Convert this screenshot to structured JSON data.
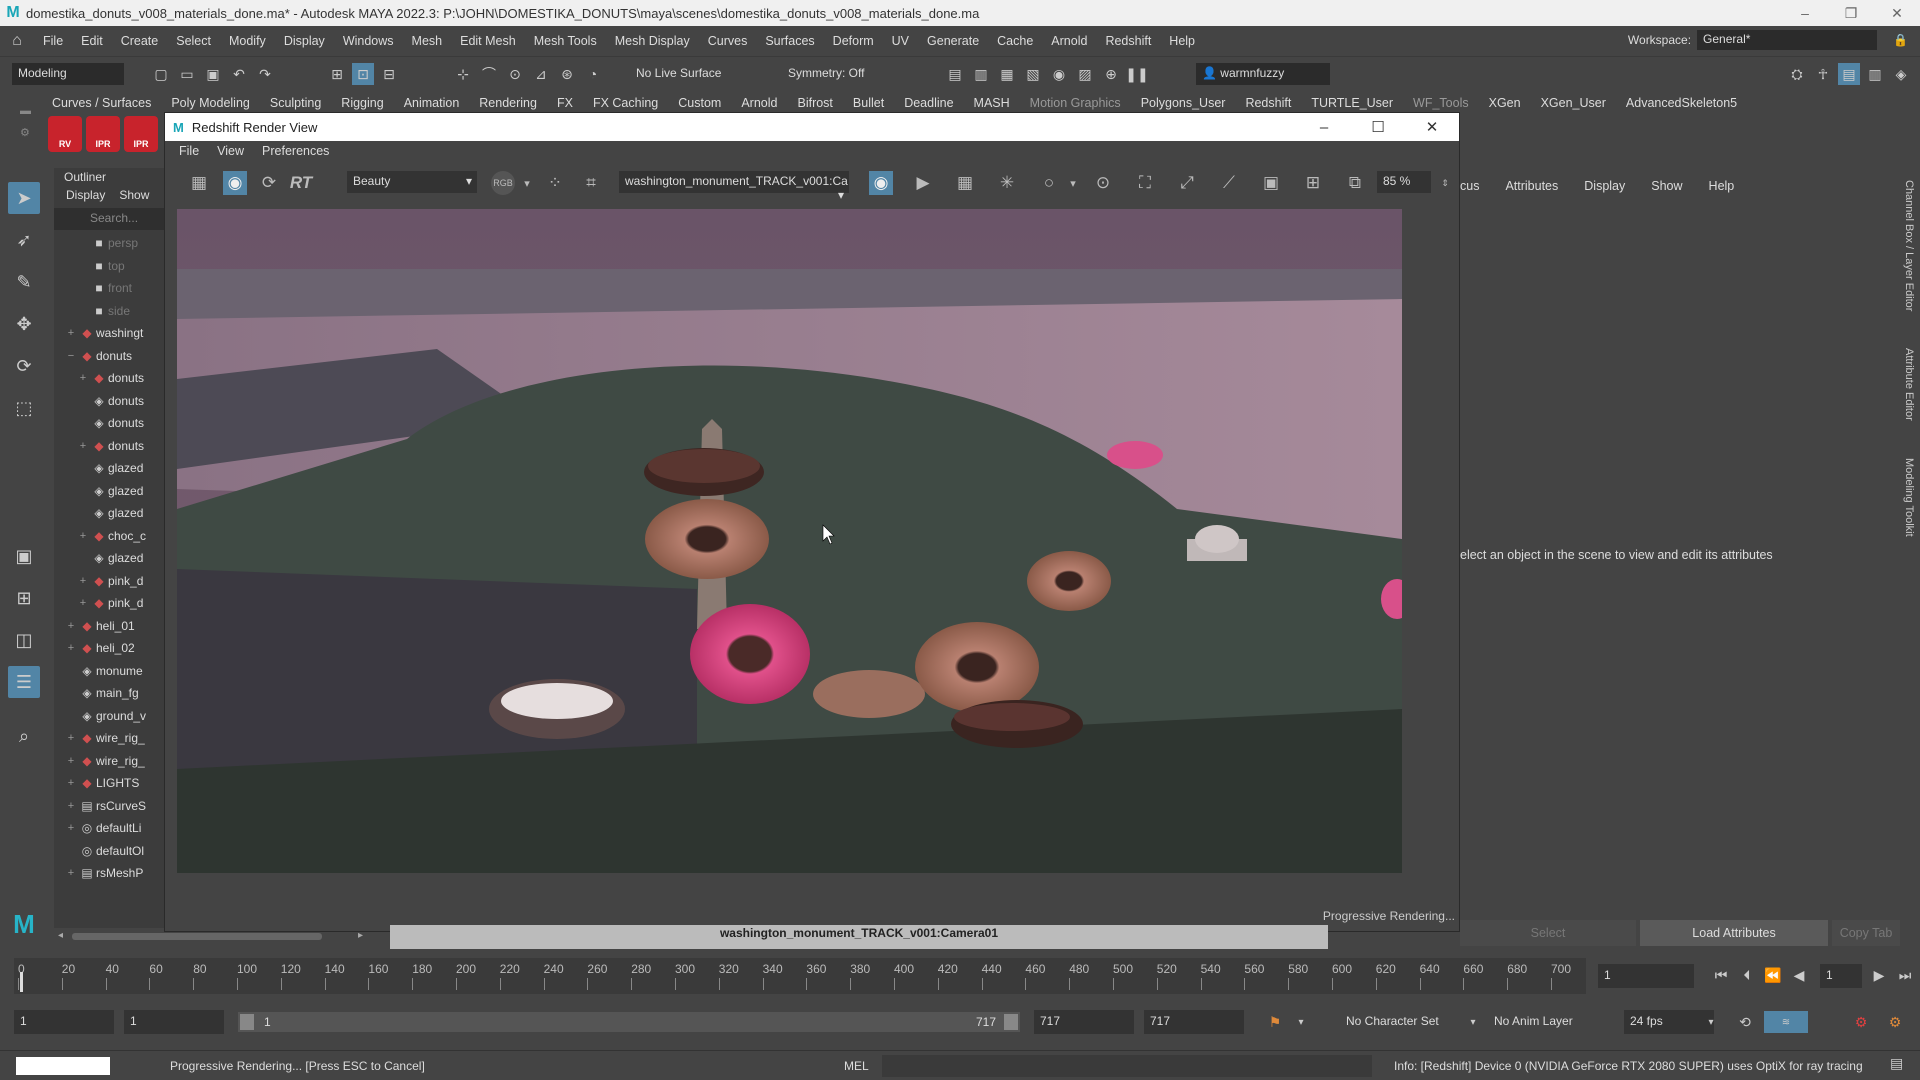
{
  "window_title": "domestika_donuts_v008_materials_done.ma* - Autodesk MAYA 2022.3: P:\\JOHN\\DOMESTIKA_DONUTS\\maya\\scenes\\domestika_donuts_v008_materials_done.ma",
  "menus": [
    "File",
    "Edit",
    "Create",
    "Select",
    "Modify",
    "Display",
    "Windows",
    "Mesh",
    "Edit Mesh",
    "Mesh Tools",
    "Mesh Display",
    "Curves",
    "Surfaces",
    "Deform",
    "UV",
    "Generate",
    "Cache",
    "Arnold",
    "Redshift",
    "Help"
  ],
  "workspace": {
    "label": "Workspace:",
    "value": "General*"
  },
  "status_line": {
    "mode": "Modeling",
    "live_surface": "No Live Surface",
    "symmetry": "Symmetry: Off",
    "user": "warmnfuzzy"
  },
  "shelf_tabs": [
    "Curves / Surfaces",
    "Poly Modeling",
    "Sculpting",
    "Rigging",
    "Animation",
    "Rendering",
    "FX",
    "FX Caching",
    "Custom",
    "Arnold",
    "Bifrost",
    "Bullet",
    "Deadline",
    "MASH",
    "Motion Graphics",
    "Polygons_User",
    "Redshift",
    "TURTLE_User",
    "WF_Tools",
    "XGen",
    "XGen_User",
    "AdvancedSkeleton5"
  ],
  "shelf_icons": [
    "RV",
    "IPR",
    "IPR"
  ],
  "outliner": {
    "title": "Outliner",
    "menu": [
      "Display",
      "Show"
    ],
    "search_placeholder": "Search...",
    "rows": [
      {
        "label": "persp",
        "pm": "",
        "icon": "camera-icon",
        "dim": true,
        "indent": 1
      },
      {
        "label": "top",
        "pm": "",
        "icon": "camera-icon",
        "dim": true,
        "indent": 1
      },
      {
        "label": "front",
        "pm": "",
        "icon": "camera-icon",
        "dim": true,
        "indent": 1
      },
      {
        "label": "side",
        "pm": "",
        "icon": "camera-icon",
        "dim": true,
        "indent": 1
      },
      {
        "label": "washingt",
        "pm": "+",
        "icon": "group-icon",
        "dim": false,
        "indent": 0
      },
      {
        "label": "donuts",
        "pm": "−",
        "icon": "group-icon",
        "dim": false,
        "indent": 0
      },
      {
        "label": "donuts",
        "pm": "+",
        "icon": "group-icon",
        "dim": false,
        "indent": 1
      },
      {
        "label": "donuts",
        "pm": "",
        "icon": "mesh-icon",
        "dim": false,
        "indent": 1
      },
      {
        "label": "donuts",
        "pm": "",
        "icon": "mesh-icon",
        "dim": false,
        "indent": 1
      },
      {
        "label": "donuts",
        "pm": "+",
        "icon": "group-icon",
        "dim": false,
        "indent": 1
      },
      {
        "label": "glazed",
        "pm": "",
        "icon": "mesh-icon",
        "dim": false,
        "indent": 1
      },
      {
        "label": "glazed",
        "pm": "",
        "icon": "mesh-icon",
        "dim": false,
        "indent": 1
      },
      {
        "label": "glazed",
        "pm": "",
        "icon": "mesh-icon",
        "dim": false,
        "indent": 1
      },
      {
        "label": "choc_c",
        "pm": "+",
        "icon": "group-icon",
        "dim": false,
        "indent": 1
      },
      {
        "label": "glazed",
        "pm": "",
        "icon": "mesh-icon",
        "dim": false,
        "indent": 1
      },
      {
        "label": "pink_d",
        "pm": "+",
        "icon": "group-icon",
        "dim": false,
        "indent": 1
      },
      {
        "label": "pink_d",
        "pm": "+",
        "icon": "group-icon",
        "dim": false,
        "indent": 1
      },
      {
        "label": "heli_01",
        "pm": "+",
        "icon": "group-icon",
        "dim": false,
        "indent": 0
      },
      {
        "label": "heli_02",
        "pm": "+",
        "icon": "group-icon",
        "dim": false,
        "indent": 0
      },
      {
        "label": "monume",
        "pm": "",
        "icon": "mesh-icon",
        "dim": false,
        "indent": 0
      },
      {
        "label": "main_fg",
        "pm": "",
        "icon": "mesh-icon",
        "dim": false,
        "indent": 0
      },
      {
        "label": "ground_v",
        "pm": "",
        "icon": "mesh-icon",
        "dim": false,
        "indent": 0
      },
      {
        "label": "wire_rig_",
        "pm": "+",
        "icon": "group-icon",
        "dim": false,
        "indent": 0
      },
      {
        "label": "wire_rig_",
        "pm": "+",
        "icon": "group-icon",
        "dim": false,
        "indent": 0
      },
      {
        "label": "LIGHTS",
        "pm": "+",
        "icon": "group-icon",
        "dim": false,
        "indent": 0
      },
      {
        "label": "rsCurveS",
        "pm": "+",
        "icon": "set-icon",
        "dim": false,
        "indent": 0
      },
      {
        "label": "defaultLi",
        "pm": "+",
        "icon": "light-set-icon",
        "dim": false,
        "indent": 0
      },
      {
        "label": "defaultOl",
        "pm": "",
        "icon": "light-set-icon",
        "dim": false,
        "indent": 0
      },
      {
        "label": "rsMeshP",
        "pm": "+",
        "icon": "set-icon",
        "dim": false,
        "indent": 0
      }
    ]
  },
  "render_view": {
    "title": "Redshift Render View",
    "menu": [
      "File",
      "View",
      "Preferences"
    ],
    "aov": "Beauty",
    "rgb": "RGB",
    "camera": "washington_monument_TRACK_v001:Ca",
    "zoom": "85 %",
    "status": "Progressive Rendering..."
  },
  "attribute_editor": {
    "tabs": [
      "cus",
      "Attributes",
      "Display",
      "Show",
      "Help"
    ],
    "message": "elect an object in the scene to view and edit its attributes",
    "buttons": [
      "Select",
      "Load Attributes",
      "Copy Tab"
    ]
  },
  "side_tabs": [
    "Channel Box / Layer Editor",
    "Attribute Editor",
    "Modeling Toolkit"
  ],
  "camera_label": "washington_monument_TRACK_v001:Camera01",
  "timeline": {
    "ticks": [
      "0",
      "20",
      "40",
      "60",
      "80",
      "100",
      "120",
      "140",
      "160",
      "180",
      "200",
      "220",
      "240",
      "260",
      "280",
      "300",
      "320",
      "340",
      "360",
      "380",
      "400",
      "420",
      "440",
      "460",
      "480",
      "500",
      "520",
      "540",
      "560",
      "580",
      "600",
      "620",
      "640",
      "660",
      "680",
      "700"
    ],
    "current_frame": "1",
    "frame_field": "1"
  },
  "range": {
    "start": "1",
    "start2": "1",
    "slider_start": "1",
    "slider_end": "717",
    "end": "717",
    "end2": "717",
    "character": "No Character Set",
    "anim_layer": "No Anim Layer",
    "fps": "24 fps"
  },
  "command_line": {
    "help": "Progressive Rendering... [Press ESC to Cancel]",
    "mel": "MEL",
    "info": "Info: [Redshift] Device 0 (NVIDIA GeForce RTX 2080 SUPER) uses OptiX for ray tracing"
  }
}
